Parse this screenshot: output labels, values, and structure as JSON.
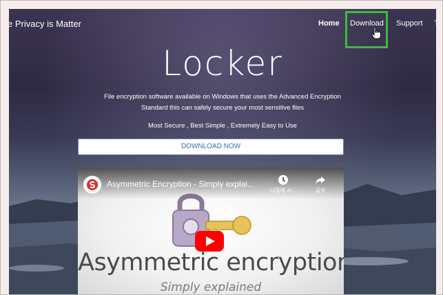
{
  "site": {
    "brand": "e Privacy is Matter"
  },
  "nav": {
    "home": "Home",
    "download": "Download",
    "support": "Support",
    "more": "T"
  },
  "hero": {
    "title": "Locker",
    "description_line1": "File encryption software available on Windows that uses the Advanced Encryption",
    "description_line2": "Standard this can safely secure your most sensitive files",
    "tagline": "Most Secure , Best Simple , Extremely Easy to Use",
    "download_button": "DOWNLOAD NOW"
  },
  "video": {
    "title": "Asymmetric Encryption - Simply explai...",
    "watch_later": "나중에 시...",
    "share": "공유",
    "thumbnail_heading": "Asymmetric encryption",
    "thumbnail_subheading": "Simply explained"
  },
  "colors": {
    "highlight": "#3dbb3d",
    "button_text": "#3a6ea8",
    "play": "#ff0000"
  },
  "icons": [
    "hand-cursor-icon",
    "clock-icon",
    "share-icon",
    "padlock-icon",
    "key-icon",
    "play-icon",
    "channel-logo-icon"
  ]
}
